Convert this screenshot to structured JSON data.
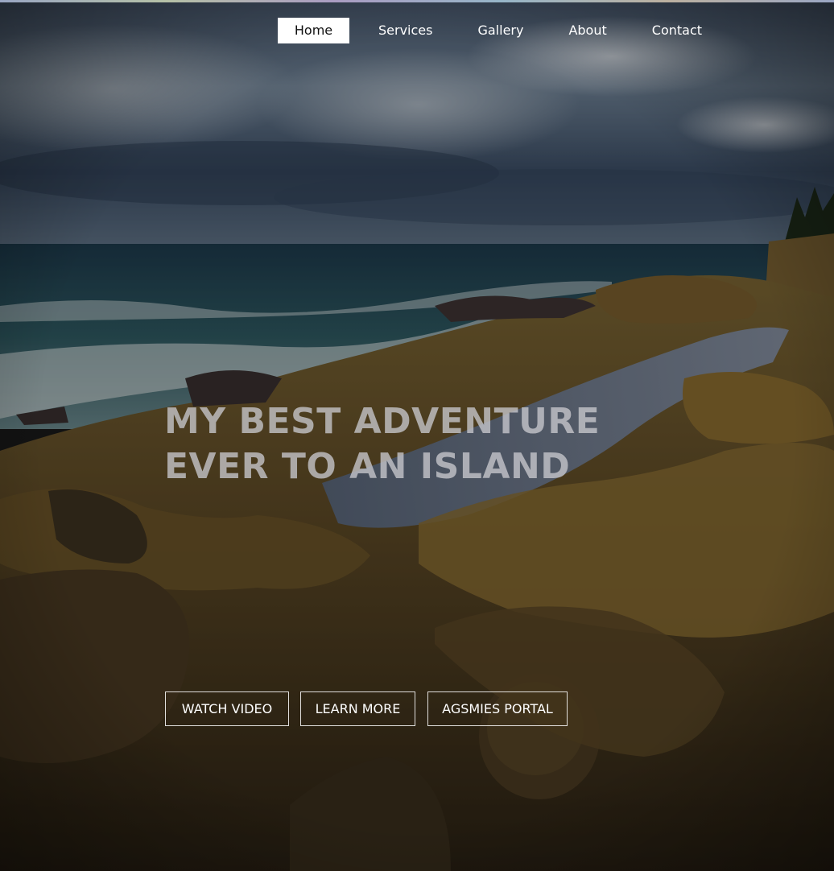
{
  "nav": {
    "items": [
      {
        "label": "Home",
        "active": true
      },
      {
        "label": "Services",
        "active": false
      },
      {
        "label": "Gallery",
        "active": false
      },
      {
        "label": "About",
        "active": false
      },
      {
        "label": "Contact",
        "active": false
      }
    ]
  },
  "hero": {
    "headline_line1": "MY BEST ADVENTURE",
    "headline_line2": "EVER TO AN ISLAND",
    "buttons": [
      {
        "label": "WATCH VIDEO"
      },
      {
        "label": "LEARN MORE"
      },
      {
        "label": "AGSMIES PORTAL"
      }
    ]
  },
  "colors": {
    "nav_active_bg": "#ffffff",
    "nav_active_text": "#111111",
    "text_light": "#ffffff",
    "headline": "#c8c8cd"
  }
}
